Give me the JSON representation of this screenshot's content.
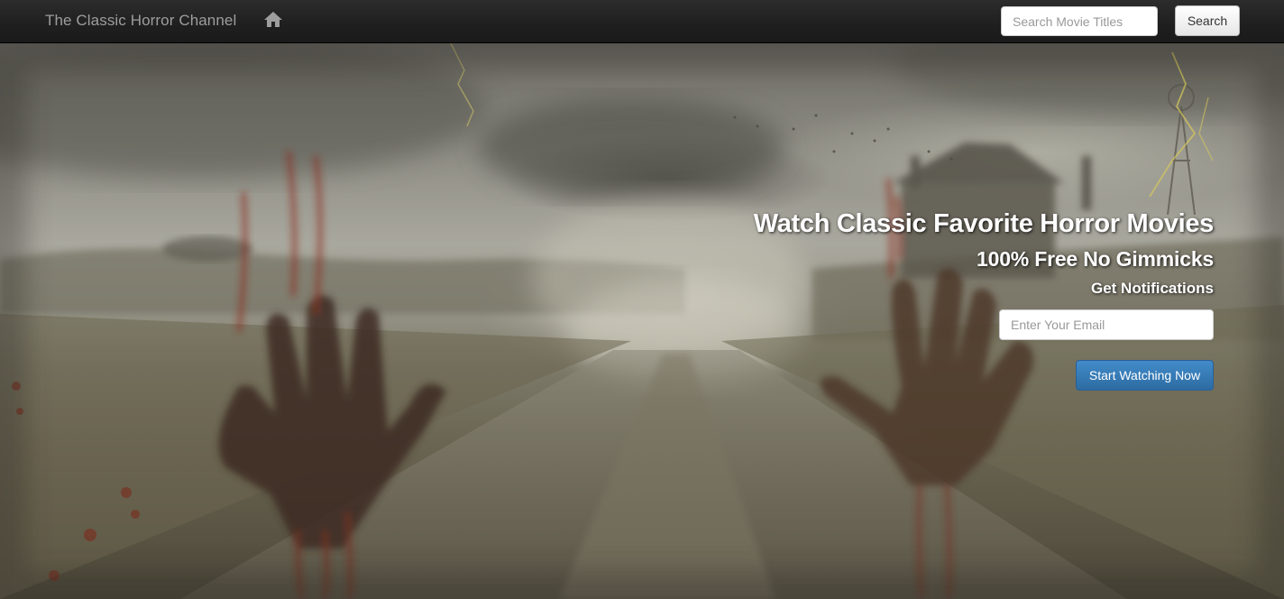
{
  "navbar": {
    "brand": "The Classic Horror Channel",
    "home_icon": "home-icon",
    "search": {
      "placeholder": "Search Movie Titles",
      "value": "",
      "button_label": "Search"
    }
  },
  "hero": {
    "headline": "Watch Classic Favorite Horror Movies",
    "subheadline": "100% Free No Gimmicks",
    "notifications_label": "Get Notifications",
    "email": {
      "placeholder": "Enter Your Email",
      "value": ""
    },
    "cta_label": "Start Watching Now",
    "background_description_icon": "horror-landscape-background"
  },
  "colors": {
    "navbar_bg": "#222222",
    "brand_text": "#9d9d9d",
    "primary_button": "#428bca",
    "hero_text": "#ffffff"
  }
}
